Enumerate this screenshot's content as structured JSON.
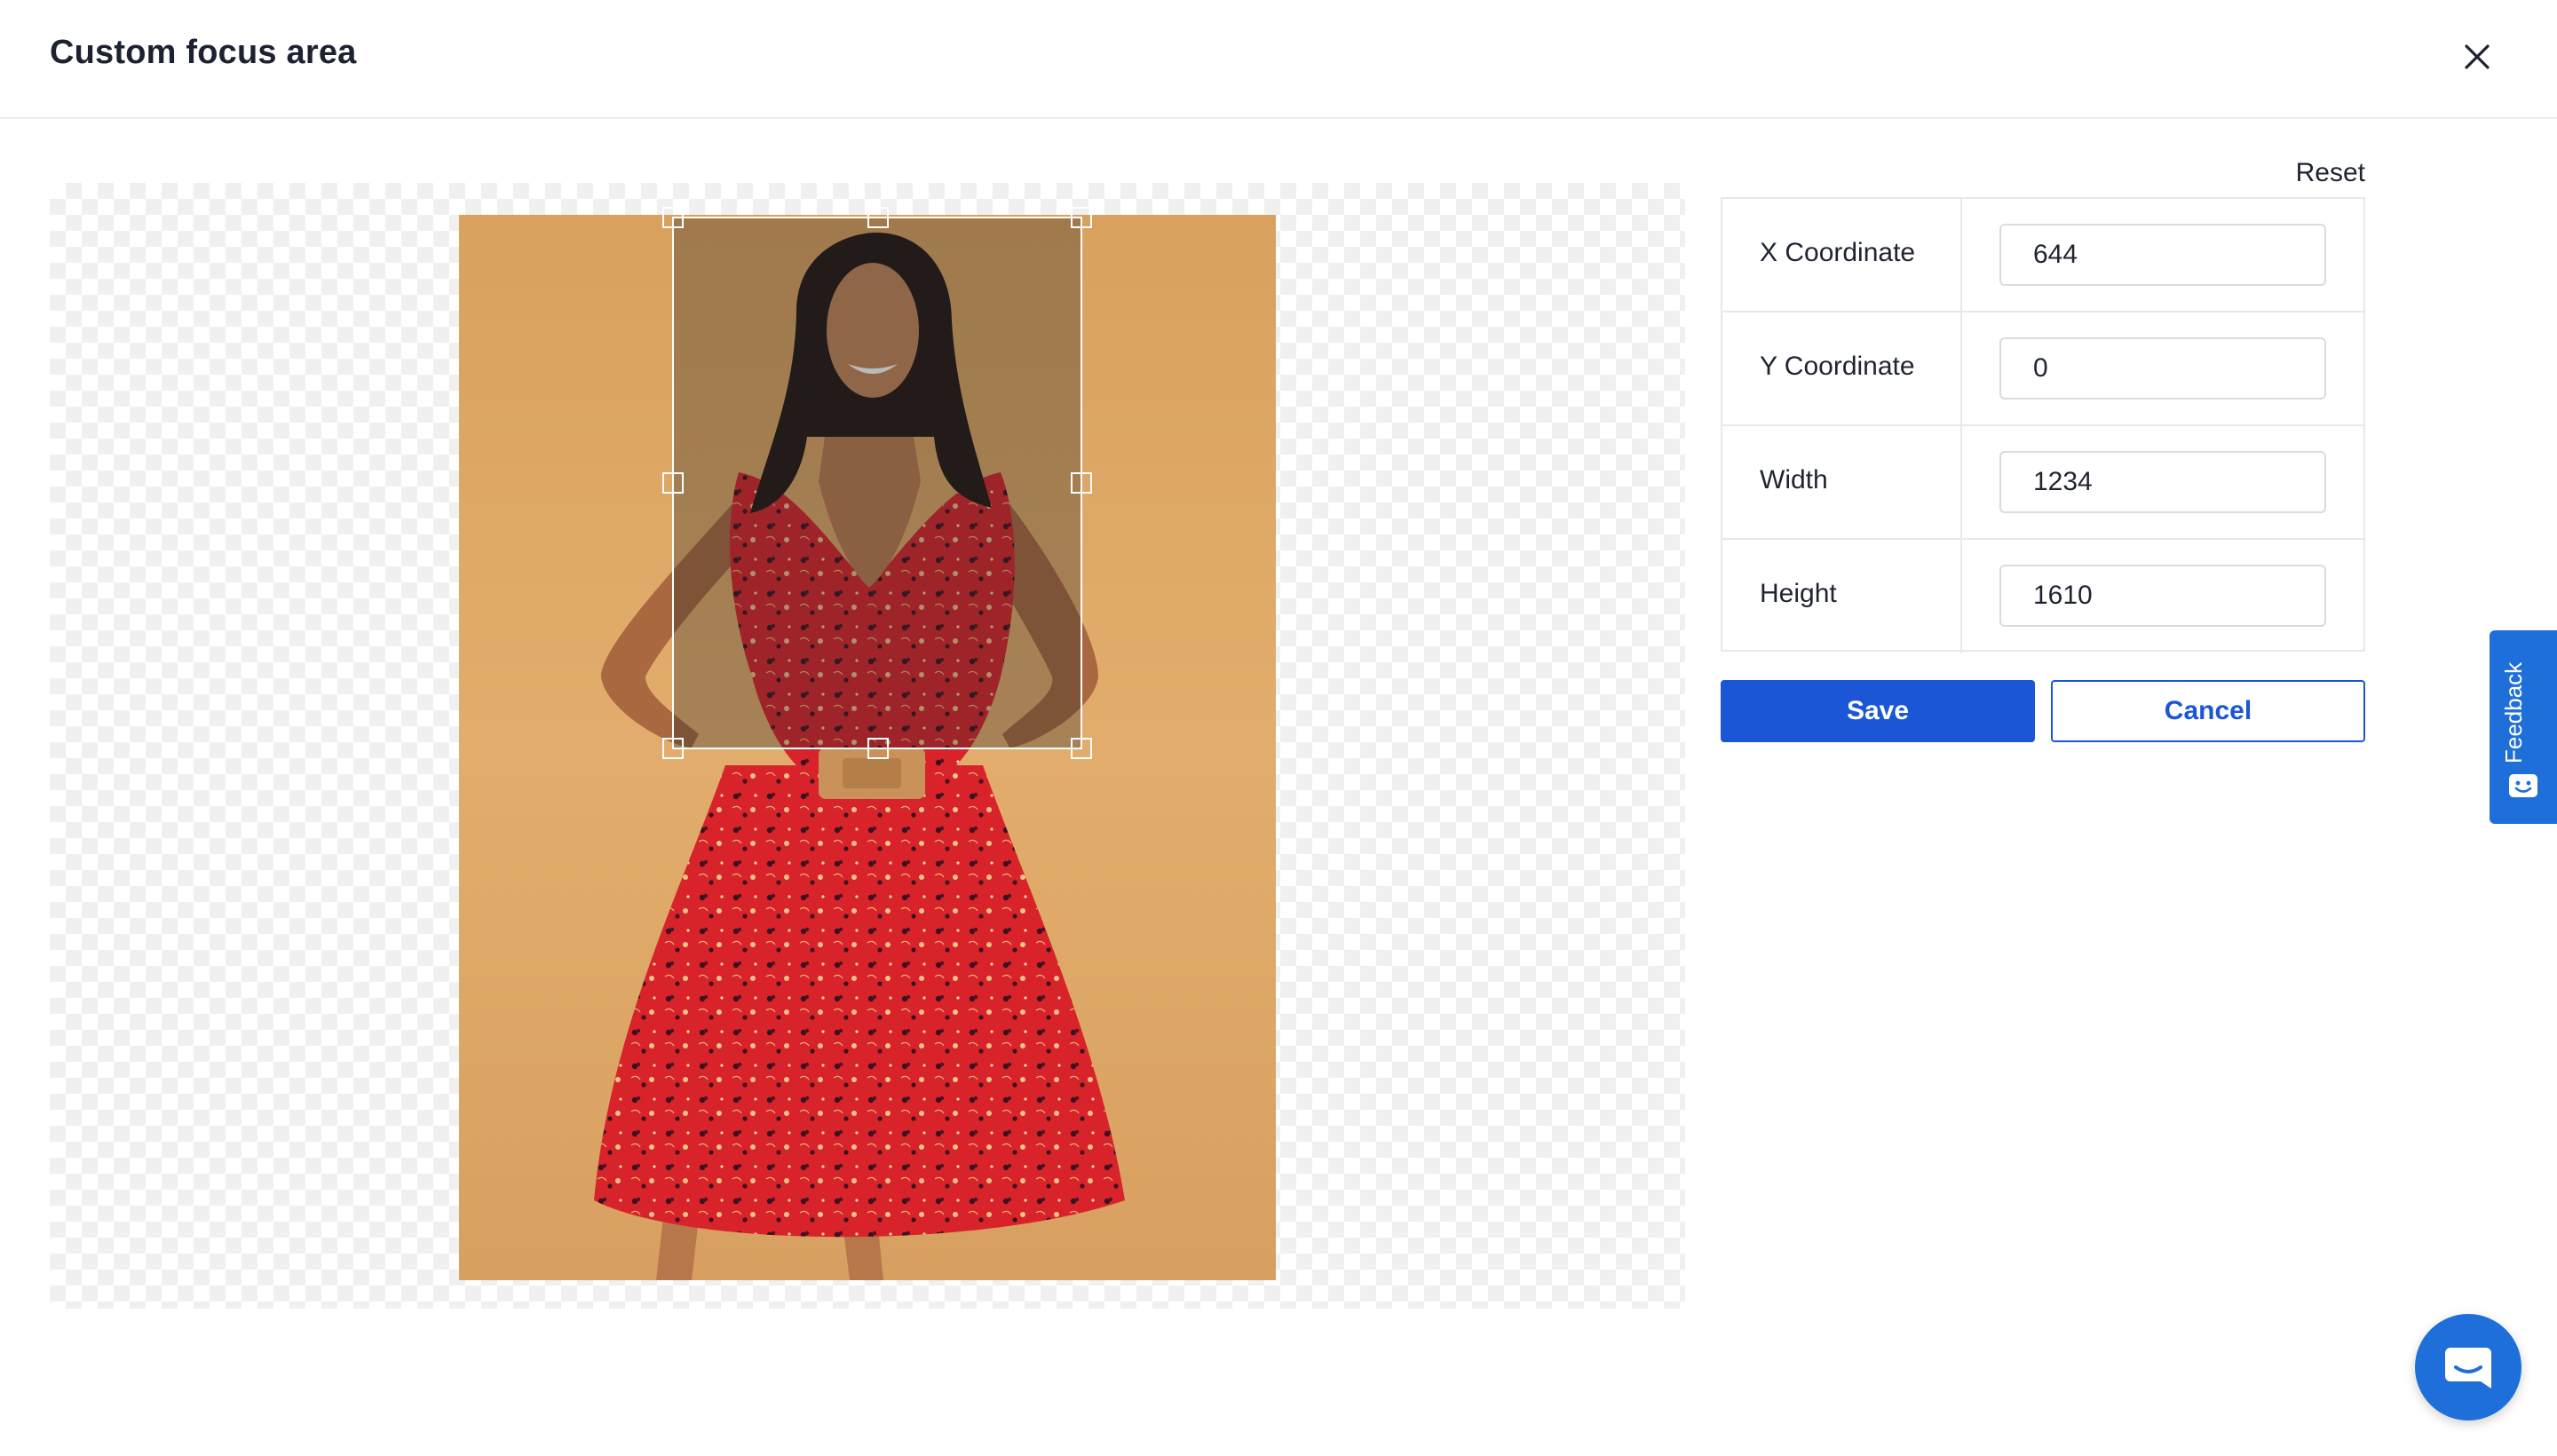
{
  "dialog": {
    "title": "Custom focus area",
    "close_icon": "close-icon"
  },
  "editor": {
    "image_alt": "Woman in red floral dress against orange backdrop",
    "crop_handles": [
      "top-left",
      "top-center",
      "top-right",
      "middle-left",
      "middle-right",
      "bottom-left",
      "bottom-center",
      "bottom-right"
    ]
  },
  "panel": {
    "reset_label": "Reset",
    "fields": [
      {
        "label": "X Coordinate",
        "value": "644"
      },
      {
        "label": "Y Coordinate",
        "value": "0"
      },
      {
        "label": "Width",
        "value": "1234"
      },
      {
        "label": "Height",
        "value": "1610"
      }
    ],
    "save_label": "Save",
    "cancel_label": "Cancel"
  },
  "feedback": {
    "label": "Feedback",
    "icon": "feedback-smiley-icon"
  },
  "chat": {
    "icon": "chat-bubble-icon"
  },
  "colors": {
    "primary": "#1a56d6",
    "feedback": "#1e6fd9",
    "backdrop": "#e0a969",
    "dress": "#d8232a"
  }
}
